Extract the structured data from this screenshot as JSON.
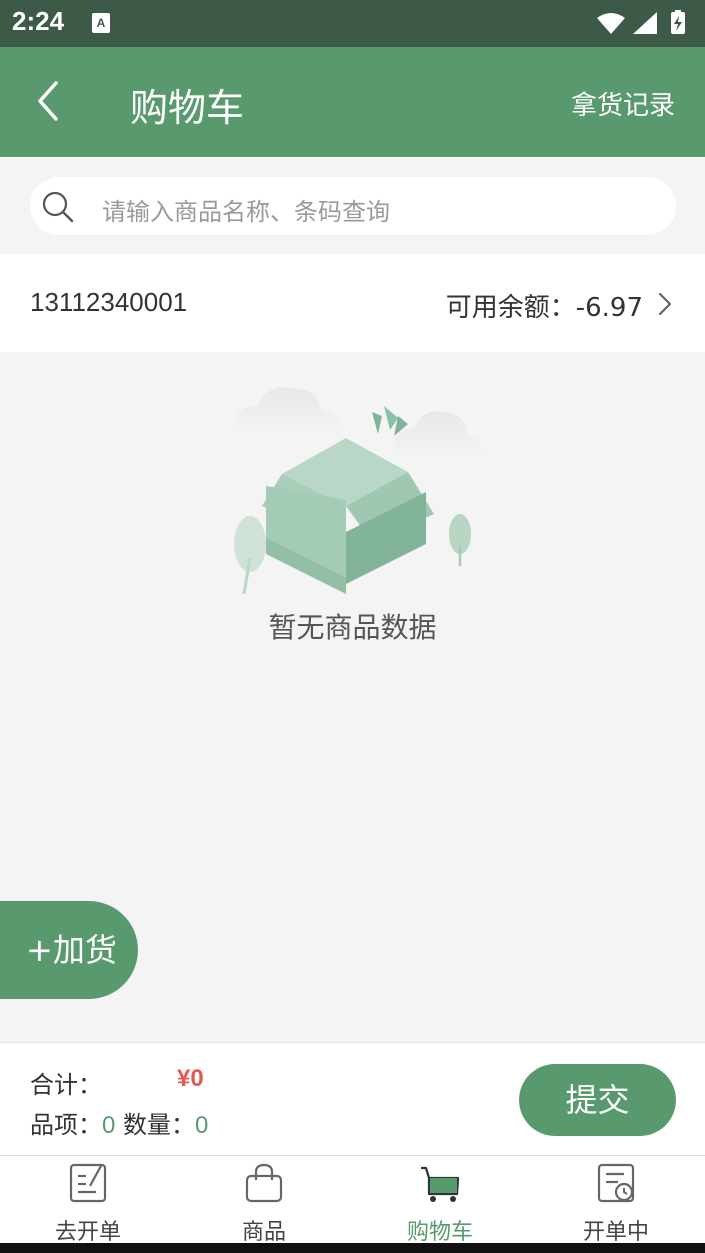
{
  "status_bar": {
    "time": "2:24",
    "notification_icon": "A"
  },
  "header": {
    "title": "购物车",
    "right_action": "拿货记录",
    "back_icon": "chevron-left-icon"
  },
  "search": {
    "placeholder": "请输入商品名称、条码查询",
    "icon": "search-icon"
  },
  "account": {
    "phone": "13112340001",
    "balance_label": "可用余额：-6.97"
  },
  "empty_state": {
    "message": "暂无商品数据",
    "illustration": "empty-box-illustration"
  },
  "fab": {
    "label": "+加货"
  },
  "summary": {
    "total_label": "合计：",
    "total_value": "¥0",
    "items_label": "品项：",
    "items_value": "0",
    "quantity_label": "数量：",
    "quantity_value": "0",
    "submit_label": "提交"
  },
  "tabs": [
    {
      "label": "去开单",
      "icon": "create-order-icon",
      "active": false
    },
    {
      "label": "商品",
      "icon": "bag-icon",
      "active": false
    },
    {
      "label": "购物车",
      "icon": "cart-icon",
      "active": true
    },
    {
      "label": "开单中",
      "icon": "pending-order-icon",
      "active": false
    }
  ],
  "colors": {
    "primary": "#589a6e",
    "status_bar": "#3d5a48",
    "price": "#e05a4e",
    "background": "#f4f4f5"
  }
}
